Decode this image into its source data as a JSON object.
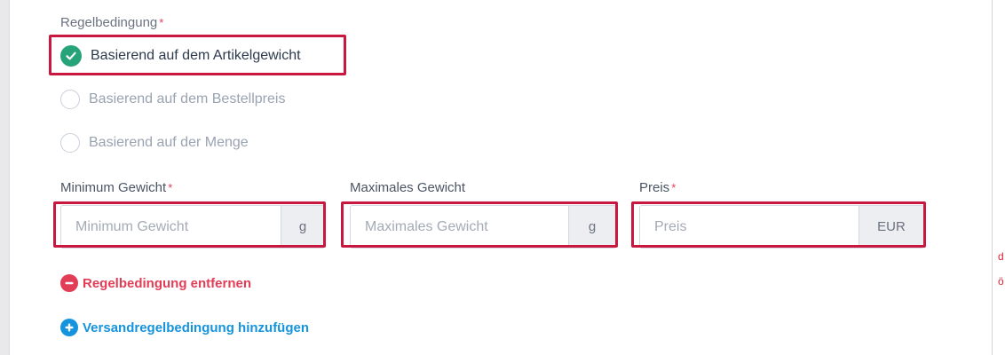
{
  "condition": {
    "label": "Regelbedingung",
    "required_mark": "*",
    "options": [
      {
        "label": "Basierend auf dem Artikelgewicht",
        "selected": true
      },
      {
        "label": "Basierend auf dem Bestellpreis",
        "selected": false
      },
      {
        "label": "Basierend auf der Menge",
        "selected": false
      }
    ]
  },
  "fields": {
    "min_weight": {
      "label": "Minimum Gewicht",
      "required_mark": "*",
      "placeholder": "Minimum Gewicht",
      "unit": "g"
    },
    "max_weight": {
      "label": "Maximales Gewicht",
      "placeholder": "Maximales Gewicht",
      "unit": "g"
    },
    "price": {
      "label": "Preis",
      "required_mark": "*",
      "placeholder": "Preis",
      "unit": "EUR"
    }
  },
  "actions": {
    "remove_condition": "Regelbedingung entfernen",
    "add_condition": "Versandregelbedingung hinzufügen"
  },
  "colors": {
    "selected_check": "#27a37a",
    "required": "#e23d57",
    "remove": "#e23d57",
    "add": "#1593dd",
    "highlight_border": "#c8183f"
  }
}
